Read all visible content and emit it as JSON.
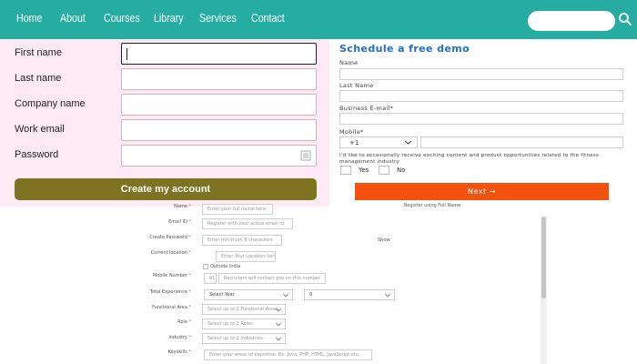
{
  "nav": {
    "items": [
      "Home",
      "About",
      "Courses",
      "Library",
      "Services",
      "Contact"
    ],
    "search_placeholder": "",
    "search_icon": "search-icon"
  },
  "signup": {
    "fields": [
      {
        "label": "First name",
        "value": ""
      },
      {
        "label": "Last name",
        "value": ""
      },
      {
        "label": "Company name",
        "value": ""
      },
      {
        "label": "Work email",
        "value": ""
      },
      {
        "label": "Password",
        "value": ""
      }
    ],
    "submit_label": "Create my account"
  },
  "demo": {
    "title": "Schedule a free demo",
    "name_label": "Name",
    "last_name_label": "Last Name",
    "email_label": "Business E-mail*",
    "mobile_label": "Mobile*",
    "country_code": "+1",
    "consent_text": "I'd like to occasionally receive exciting content and product opportunities related to the fitness management industry",
    "yes_label": "Yes",
    "no_label": "No",
    "next_label": "Next  →"
  },
  "registration": {
    "register_full_name_link": "Register using Full Name",
    "name_label": "Name",
    "name_placeholder": "Enter your full name here",
    "email_label": "Email ID",
    "email_placeholder": "Register with your active email id",
    "password_label": "Create Password",
    "password_placeholder": "Enter minimum 6 characters",
    "show_label": "Show",
    "location_label": "Current location",
    "location_placeholder": "Enter Your Location here",
    "outside_india_label": "Outside India",
    "mobile_label": "Mobile Number",
    "mobile_code": "91",
    "mobile_placeholder": "Recruiters will contact you on this number",
    "experience_label": "Total Experience",
    "experience_year": "Select Year",
    "experience_month": "0",
    "functional_area_label": "Functional Area",
    "functional_area_placeholder": "Select up to 2 Functional Areas",
    "role_label": "Role",
    "role_placeholder": "Select up to 2 Roles",
    "industry_label": "Industry",
    "industry_placeholder": "Select up to 2 Industries",
    "keyskills_label": "Keyskills",
    "keyskills_placeholder": "Enter your areas of expertise. Ex: Java, PHP, HTML, JavaScript etc.",
    "required_mark": "*"
  },
  "colors": {
    "nav_bg": "#26ada1",
    "signup_bg": "#fdeaf4",
    "create_btn": "#7e7322",
    "demo_title": "#1f6fd0",
    "next_btn": "#f2520e"
  }
}
